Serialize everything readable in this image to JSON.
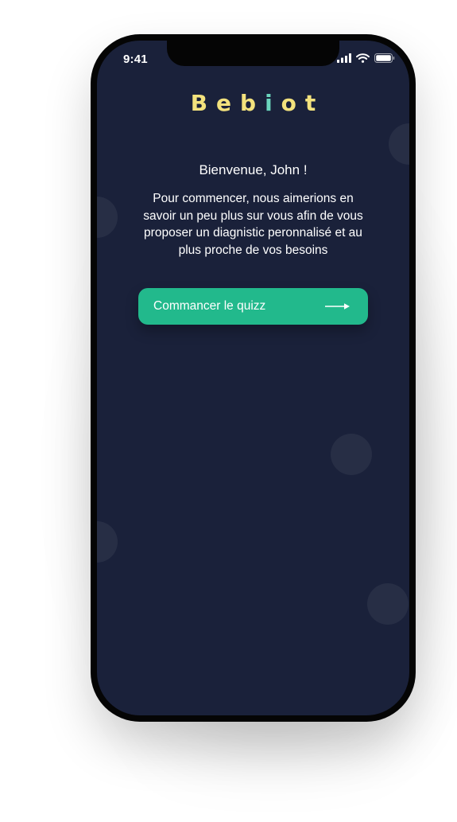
{
  "status_bar": {
    "time": "9:41",
    "icons": [
      "signal-icon",
      "wifi-icon",
      "battery-icon"
    ]
  },
  "app": {
    "logo_parts": [
      "Beb",
      "i",
      "ot"
    ],
    "logo_color": "#f3e27d",
    "logo_accent_color": "#6bd5bd"
  },
  "welcome": {
    "greeting": "Bienvenue, John !",
    "intro": "Pour commencer, nous aimerions en savoir un peu plus sur vous afin de vous proposer un diagnistic peronnalisé et au plus proche de vos besoins"
  },
  "cta": {
    "label": "Commancer le quizz",
    "icon": "arrow-right-icon",
    "color": "#22b98c"
  },
  "theme": {
    "screen_background": "#1a213a"
  }
}
